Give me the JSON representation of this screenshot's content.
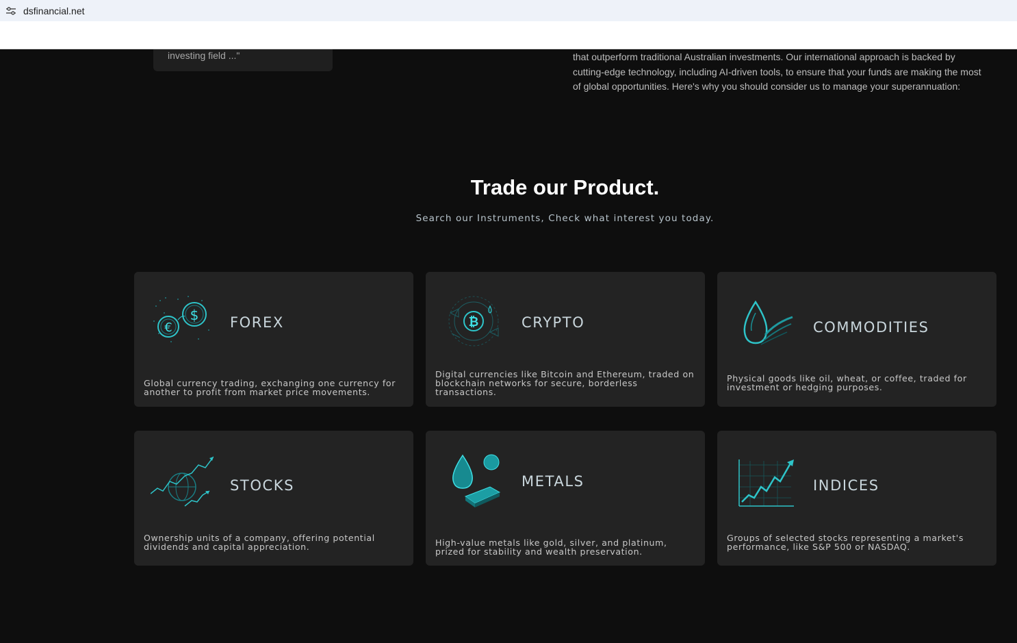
{
  "browser": {
    "url": "dsfinancial.net"
  },
  "top": {
    "quote_fragment": "investing field ...\"",
    "intro_text": "that outperform traditional Australian investments. Our international approach is backed by cutting-edge technology, including AI-driven tools, to ensure that your funds are making the most of global opportunities. Here's why you should consider us to manage your superannuation:"
  },
  "section": {
    "title": "Trade our Product.",
    "subtitle": "Search our Instruments, Check what interest you today."
  },
  "colors": {
    "page_bg": "#0e0e0e",
    "card_bg": "#232323",
    "accent": "#2ec4c9"
  },
  "products": [
    {
      "title": "FOREX",
      "icon": "currency-exchange-icon",
      "description": "Global currency trading, exchanging one currency for another to profit from market price movements."
    },
    {
      "title": "CRYPTO",
      "icon": "bitcoin-icon",
      "description": "Digital currencies like Bitcoin and Ethereum, traded on blockchain networks for secure, borderless transactions."
    },
    {
      "title": "COMMODITIES",
      "icon": "oil-drop-icon",
      "description": "Physical goods like oil, wheat, or coffee, traded for investment or hedging purposes."
    },
    {
      "title": "STOCKS",
      "icon": "stock-chart-icon",
      "description": "Ownership units of a company, offering potential dividends and capital appreciation."
    },
    {
      "title": "METALS",
      "icon": "metal-bar-icon",
      "description": "High-value metals like gold, silver, and platinum, prized for stability and wealth preservation."
    },
    {
      "title": "INDICES",
      "icon": "index-chart-icon",
      "description": "Groups of selected stocks representing a market's performance, like S&P 500 or NASDAQ."
    }
  ]
}
